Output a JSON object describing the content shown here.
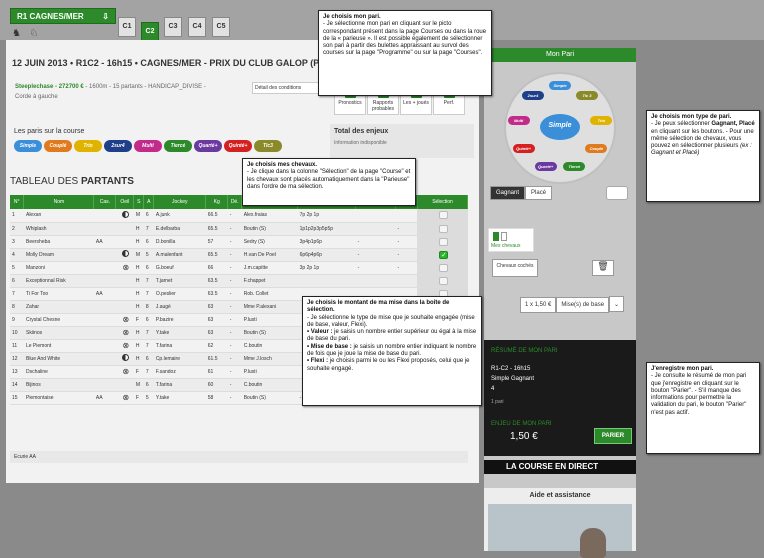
{
  "header": {
    "meeting": "R1 CAGNES/MER",
    "races": [
      "C1",
      "C2",
      "C3",
      "C4",
      "C5"
    ],
    "active_race": "C2",
    "c2_badge": "GALOP",
    "c5_badge": "QUINTE"
  },
  "race": {
    "date_title": "12 JUIN 2013 • R1C2 - 16h15 • CAGNES/MER - PRIX DU CLUB GALOP (PR",
    "type": "Steeplechase - 272700 € ",
    "info": "- 1600m - 15 partants - HANDICAP_DIVISE -",
    "corde": "Corde à gauche",
    "conditions_label": "Détail des conditions"
  },
  "tools": [
    {
      "label": "Pronostics"
    },
    {
      "label": "Rapports probables"
    },
    {
      "label": "Les + joués"
    },
    {
      "label": "Perf."
    }
  ],
  "paris": {
    "label": "Les paris sur la course",
    "types": [
      {
        "name": "Simple",
        "color": "#3a8fd8"
      },
      {
        "name": "Couplé",
        "color": "#e07a1e"
      },
      {
        "name": "Trio",
        "color": "#e0b300"
      },
      {
        "name": "2sur4",
        "color": "#1f3f8a"
      },
      {
        "name": "Multi",
        "color": "#c22b8a"
      },
      {
        "name": "Tiercé",
        "color": "#2d8a2b"
      },
      {
        "name": "Quarté+",
        "color": "#6a3aa0"
      },
      {
        "name": "Quinté+",
        "color": "#d42020"
      },
      {
        "name": "Tic3",
        "color": "#8a8a2a"
      }
    ]
  },
  "enjeux": {
    "title": "Total des enjeux",
    "value": "Information indisponible"
  },
  "table": {
    "title_light": "TABLEAU DES ",
    "title_bold": "PARTANTS",
    "headers": [
      "N°",
      "Nom",
      "Cas.",
      "Oeil",
      "S",
      "A",
      "Jockey",
      "Kg",
      "Dé.",
      "Ent.",
      "Musique",
      "Gains",
      "Cote",
      "Sélection"
    ],
    "rows": [
      {
        "n": "1",
        "name": "Alexan",
        "cas": "",
        "oeil": "half",
        "s": "M",
        "a": "6",
        "jockey": "A.junk",
        "kg": "66.5",
        "de": "-",
        "ent": "Alex.fraias",
        "musique": "7p 2p 1p",
        "gains": "",
        "cote": "",
        "sel": false
      },
      {
        "n": "2",
        "name": "Whiplash",
        "cas": "",
        "oeil": "",
        "s": "H",
        "a": "7",
        "jockey": "E.delbarba",
        "kg": "65.5",
        "de": "-",
        "ent": "Boutin (S)",
        "musique": "1p1p2p3p5p5p",
        "gains": "",
        "cote": "-",
        "sel": false
      },
      {
        "n": "3",
        "name": "Beersheba",
        "cas": "AA",
        "oeil": "",
        "s": "H",
        "a": "6",
        "jockey": "D.bonilla",
        "kg": "57",
        "de": "-",
        "ent": "Sedry (S)",
        "musique": "3p4p1p6p",
        "gains": "-",
        "cote": "-",
        "sel": false
      },
      {
        "n": "4",
        "name": "Molly Dream",
        "cas": "",
        "oeil": "half",
        "s": "M",
        "a": "5",
        "jockey": "A.malenfant",
        "kg": "65.5",
        "de": "-",
        "ent": "H.van De Poel",
        "musique": "6p6p4p6p",
        "gains": "-",
        "cote": "-",
        "sel": true
      },
      {
        "n": "5",
        "name": "Manzoni",
        "cas": "",
        "oeil": "x",
        "s": "H",
        "a": "6",
        "jockey": "G.boeuf",
        "kg": "66",
        "de": "-",
        "ent": "J.m.capitte",
        "musique": "3p 2p 1p",
        "gains": "-",
        "cote": "-",
        "sel": false
      },
      {
        "n": "6",
        "name": "Exceptionnal Risk",
        "cas": "",
        "oeil": "",
        "s": "H",
        "a": "7",
        "jockey": "T.jarnet",
        "kg": "63.5",
        "de": "-",
        "ent": "F.chappet",
        "musique": "",
        "gains": "",
        "cote": "",
        "sel": false
      },
      {
        "n": "7",
        "name": "Ti For Too",
        "cas": "AA",
        "oeil": "",
        "s": "H",
        "a": "7",
        "jockey": "O.peslier",
        "kg": "63.5",
        "de": "-",
        "ent": "Rob. Collet",
        "musique": "",
        "gains": "",
        "cote": "",
        "sel": false
      },
      {
        "n": "8",
        "name": "Zahar",
        "cas": "",
        "oeil": "",
        "s": "H",
        "a": "8",
        "jockey": "J.augé",
        "kg": "63",
        "de": "-",
        "ent": "Mme P.alexani",
        "musique": "",
        "gains": "",
        "cote": "",
        "sel": false
      },
      {
        "n": "9",
        "name": "Crystal Chesne",
        "cas": "",
        "oeil": "x",
        "s": "F",
        "a": "6",
        "jockey": "P.bazire",
        "kg": "63",
        "de": "-",
        "ent": "P.lusti",
        "musique": "",
        "gains": "",
        "cote": "",
        "sel": false
      },
      {
        "n": "10",
        "name": "Skiinos",
        "cas": "",
        "oeil": "x",
        "s": "H",
        "a": "7",
        "jockey": "Y.take",
        "kg": "63",
        "de": "-",
        "ent": "Boutin (S)",
        "musique": "",
        "gains": "",
        "cote": "",
        "sel": false
      },
      {
        "n": "11",
        "name": "Le Piemont",
        "cas": "",
        "oeil": "x",
        "s": "H",
        "a": "7",
        "jockey": "T.farina",
        "kg": "62",
        "de": "-",
        "ent": "C.boutin",
        "musique": "",
        "gains": "",
        "cote": "",
        "sel": false
      },
      {
        "n": "12",
        "name": "Blue And White",
        "cas": "",
        "oeil": "half",
        "s": "H",
        "a": "6",
        "jockey": "Cp.lemaire",
        "kg": "61.5",
        "de": "-",
        "ent": "Mme J.losch",
        "musique": "",
        "gains": "",
        "cote": "",
        "sel": false
      },
      {
        "n": "13",
        "name": "Dschaline",
        "cas": "",
        "oeil": "x",
        "s": "F",
        "a": "7",
        "jockey": "F.sandoz",
        "kg": "61",
        "de": "-",
        "ent": "P.lusti",
        "musique": "",
        "gains": "",
        "cote": "",
        "sel": false
      },
      {
        "n": "14",
        "name": "Bijinos",
        "cas": "",
        "oeil": "",
        "s": "M",
        "a": "6",
        "jockey": "T.farina",
        "kg": "60",
        "de": "-",
        "ent": "C.boutin",
        "musique": "",
        "gains": "",
        "cote": "",
        "sel": false
      },
      {
        "n": "15",
        "name": "Piemontaise",
        "cas": "AA",
        "oeil": "x",
        "s": "F",
        "a": "5",
        "jockey": "Y.take",
        "kg": "58",
        "de": "-",
        "ent": "Boutin (S)",
        "musique": "-",
        "gains": "-",
        "cote": "",
        "sel": false
      }
    ],
    "ecurie": "Ecurie AA"
  },
  "sidebar": {
    "title": "Mon Pari",
    "wheel": [
      {
        "name": "Simple",
        "color": "#3a8fd8"
      },
      {
        "name": "Tic 3",
        "color": "#8a8a2a"
      },
      {
        "name": "Trio",
        "color": "#e0b300"
      },
      {
        "name": "Couplé",
        "color": "#e07a1e"
      },
      {
        "name": "Tiercé",
        "color": "#2d8a2b"
      },
      {
        "name": "Quarté+",
        "color": "#6a3aa0"
      },
      {
        "name": "Quinté+",
        "color": "#d42020"
      },
      {
        "name": "Multi",
        "color": "#c22b8a"
      },
      {
        "name": "2sur4",
        "color": "#1f3f8a"
      }
    ],
    "center": "Simple",
    "gagnant": "Gagnant",
    "place": "Placé",
    "mes_chevaux": "Mes chevaux",
    "chevaux_coches": "Chevaux cochés",
    "mise_value": "1 x 1,50 €",
    "mise_select": "Mise(s) de base"
  },
  "resume": {
    "title": "RÉSUMÉ DE MON PARI",
    "line1": "R1-C2 - 16h15",
    "line2": "Simple Gagnant",
    "line3": "4",
    "line4": "1 pari",
    "enjeu_label": "ENJEU DE MON PARI",
    "amount": "1,50 €",
    "parier": "PARIER"
  },
  "direct": "LA COURSE EN DIRECT",
  "aide": "Aide et assistance",
  "callouts": {
    "c1_title": "Je choisis mon pari.",
    "c1_body": "- Je sélectionne mon pari en cliquant sur le picto correspondant présent dans la page Courses ou dans la roue de la « parieuse ». Il est possible également de sélectionner son pari à partir des bulettes appraissant au survol des courses sur la page \"Programme\" ou sur la page \"Courses\".",
    "c2_title": "Je choisis mon type de pari.",
    "c2_body": "- Je peux sélectionner ",
    "c2_bold": "Gagnant, Placé",
    "c2_body2": " en cliquant sur les boutons. - Pour une même sélection de chevaux, vous pouvez en sélectionner plusieurs ",
    "c2_ex": "(ex : Gagnant et Placé)",
    "c3_title": "Je choisis mes chevaux.",
    "c3_body": "- Je clique dans la colonne \"Sélection\" de la page \"Course\" et les chevaux sont placés automatiquement dans la \"Parieuse\" dans l'ordre de ma sélection.",
    "c4_title": "Je choisis le montant de ma mise dans la boîte de sélection.",
    "c4_body": "- Je sélectionne le type de mise que je souhaite engagée (mise de base, valeur, Flexi).",
    "c4_b1": "• Valeur :",
    "c4_t1": " je saisis un nombre entier supérieur ou égal à la mise de base du pari.",
    "c4_b2": "• Mise de base :",
    "c4_t2": " je saisis un nombre entier indiquant le nombre de fois que je joue la mise de base du pari.",
    "c4_b3": "• Flexi :",
    "c4_t3": " je choisis parmi le ou les Flexi proposés, celui que je souhaite engagé.",
    "c5_title": "J'enregistre mon pari.",
    "c5_body": "- Je consulte le résumé de mon pari que j'enregistre en cliquant sur le bouton \"Parier\". - S'il manque des informations pour permettre la validation du pari, le bouton \"Parier\" n'est pas actif."
  }
}
